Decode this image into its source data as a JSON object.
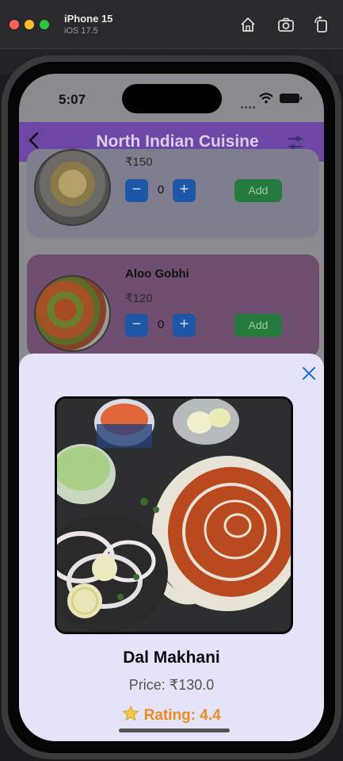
{
  "simulator": {
    "device_name": "iPhone 15",
    "os_version": "iOS 17.5",
    "tools": [
      "home-icon",
      "screenshot-icon",
      "rotate-icon"
    ]
  },
  "status_bar": {
    "time": "5:07"
  },
  "navbar": {
    "title": "North Indian Cuisine",
    "back_icon": "chevron-left-icon",
    "filter_icon": "filter-icon",
    "color": "#6e47a6"
  },
  "menu_items": [
    {
      "name": "",
      "price": "₹150",
      "quantity": "0",
      "decrement_label": "−",
      "increment_label": "+",
      "add_label": "Add"
    },
    {
      "name": "Aloo Gobhi",
      "price": "₹120",
      "quantity": "0",
      "decrement_label": "−",
      "increment_label": "+",
      "add_label": "Add"
    }
  ],
  "detail_sheet": {
    "dish_name": "Dal Makhani",
    "price_text": "Price: ₹130.0",
    "rating_text": "Rating: 4.4",
    "rating_icon": "star-icon",
    "close_icon": "close-icon",
    "background": "#e4e3f8",
    "rating_color": "#ef8a1e"
  },
  "colors": {
    "qty_button": "#1e56a8",
    "add_button": "#237a3c"
  }
}
